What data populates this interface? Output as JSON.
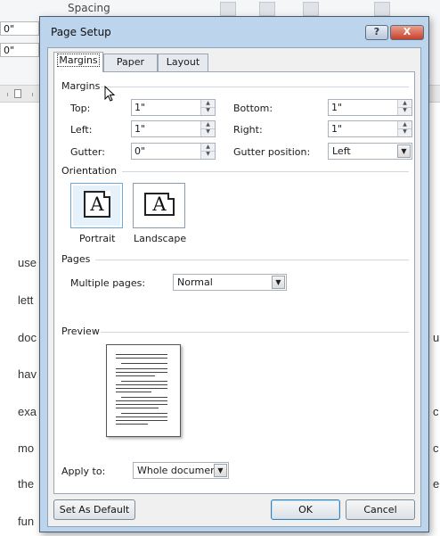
{
  "background": {
    "ribbon_label": "Spacing",
    "field_top": "0\"",
    "field_bottom": "0\"",
    "left_words": [
      "use",
      "lett",
      "doc",
      "hav",
      "exa",
      "mo",
      "the",
      "fun"
    ],
    "right_chars": [
      "u",
      "c",
      "c",
      "e"
    ]
  },
  "dialog": {
    "title": "Page Setup",
    "help_label": "?",
    "close_label": "X",
    "tabs": [
      {
        "label": "Margins",
        "active": true
      },
      {
        "label": "Paper",
        "active": false
      },
      {
        "label": "Layout",
        "active": false
      }
    ],
    "margins": {
      "section_label": "Margins",
      "top": {
        "label": "Top:",
        "value": "1\""
      },
      "left": {
        "label": "Left:",
        "value": "1\""
      },
      "gutter": {
        "label": "Gutter:",
        "value": "0\""
      },
      "bottom": {
        "label": "Bottom:",
        "value": "1\""
      },
      "right": {
        "label": "Right:",
        "value": "1\""
      },
      "gutter_position": {
        "label": "Gutter position:",
        "value": "Left"
      }
    },
    "orientation": {
      "section_label": "Orientation",
      "glyph": "A",
      "portrait_label": "Portrait",
      "landscape_label": "Landscape",
      "selected": "portrait"
    },
    "pages": {
      "section_label": "Pages",
      "multiple_pages_label": "Multiple pages:",
      "multiple_pages_value": "Normal"
    },
    "preview": {
      "section_label": "Preview",
      "apply_to_label": "Apply to:",
      "apply_to_value": "Whole document"
    },
    "buttons": {
      "set_as_default": "Set As Default",
      "ok": "OK",
      "cancel": "Cancel"
    }
  }
}
